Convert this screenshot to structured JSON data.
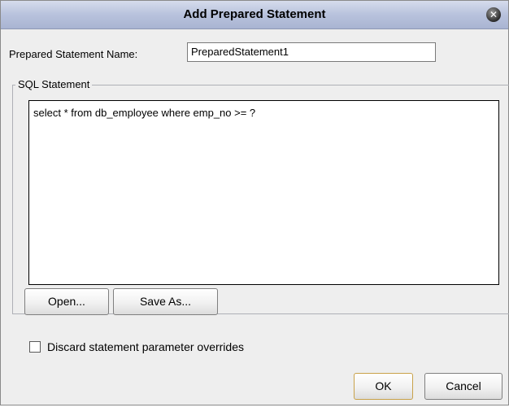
{
  "dialog": {
    "title": "Add Prepared Statement",
    "close_glyph": "✕"
  },
  "name_field": {
    "label": "Prepared Statement Name:",
    "value": "PreparedStatement1"
  },
  "sql_group": {
    "legend": "SQL Statement",
    "statement": "select * from db_employee where emp_no >= ?"
  },
  "buttons": {
    "open": "Open...",
    "save_as": "Save As...",
    "ok": "OK",
    "cancel": "Cancel"
  },
  "discard_checkbox": {
    "label": "Discard statement parameter overrides",
    "checked": false
  },
  "colors": {
    "titlebar": "#b9c3dd",
    "dialog_bg": "#eeeeee",
    "ok_focus_border": "#c9a24a"
  },
  "icons": {
    "close": "close-icon"
  }
}
